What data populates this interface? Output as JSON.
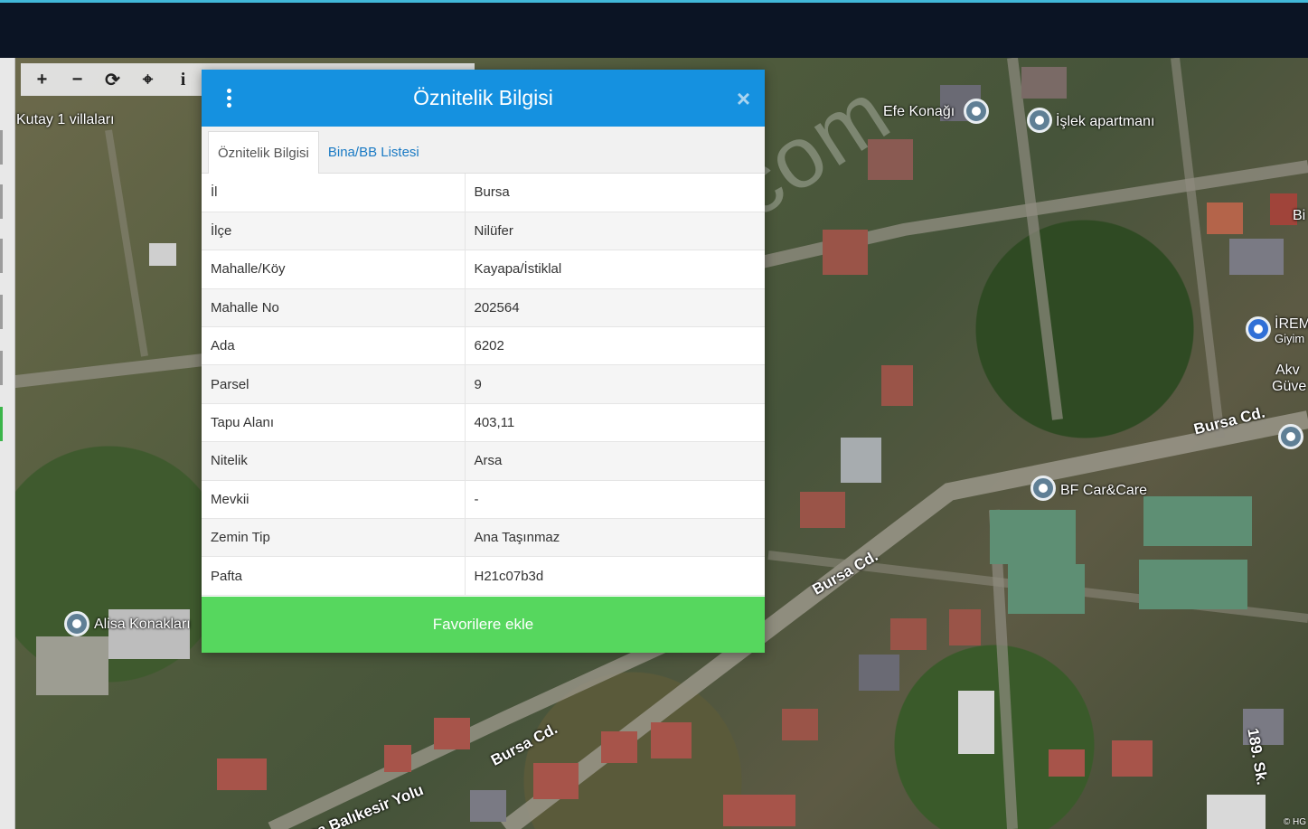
{
  "toolbar": {
    "zoom_in": "+",
    "zoom_out": "−",
    "refresh": "⟳",
    "locate": "⌖",
    "info": "i"
  },
  "map": {
    "places": {
      "kutay": "Kutay 1 villaları",
      "efe": "Efe Konağı",
      "islek": "İşlek apartmanı",
      "irem": "İREM",
      "irem_sub": "Giyim",
      "akv": "Akv",
      "guve": "Güve",
      "bi": "Bi",
      "bf": "BF Car&Care",
      "alisa": "Alisa Konakları"
    },
    "roads": {
      "bursa_cd_1": "Bursa Cd.",
      "bursa_cd_2": "Bursa Cd.",
      "bursa_cd_3": "Bursa Cd.",
      "balikesir": "Bursa Balıkesir Yolu",
      "sk": "189. Sk."
    },
    "copyright": "© HG",
    "watermark": "emlakjet.com"
  },
  "dialog": {
    "title": "Öznitelik Bilgisi",
    "close": "×",
    "tabs": [
      "Öznitelik Bilgisi",
      "Bina/BB Listesi"
    ],
    "rows": [
      {
        "key": "İl",
        "value": "Bursa"
      },
      {
        "key": "İlçe",
        "value": "Nilüfer"
      },
      {
        "key": "Mahalle/Köy",
        "value": "Kayapa/İstiklal"
      },
      {
        "key": "Mahalle No",
        "value": "202564"
      },
      {
        "key": "Ada",
        "value": "6202"
      },
      {
        "key": "Parsel",
        "value": "9"
      },
      {
        "key": "Tapu Alanı",
        "value": "403,11"
      },
      {
        "key": "Nitelik",
        "value": "Arsa"
      },
      {
        "key": "Mevkii",
        "value": "-"
      },
      {
        "key": "Zemin Tip",
        "value": "Ana Taşınmaz"
      },
      {
        "key": "Pafta",
        "value": "H21c07b3d"
      }
    ],
    "favorite_button": "Favorilere ekle"
  },
  "colors": {
    "header": "#1591e0",
    "favorite": "#56d75e",
    "topbar": "#0b1424"
  }
}
